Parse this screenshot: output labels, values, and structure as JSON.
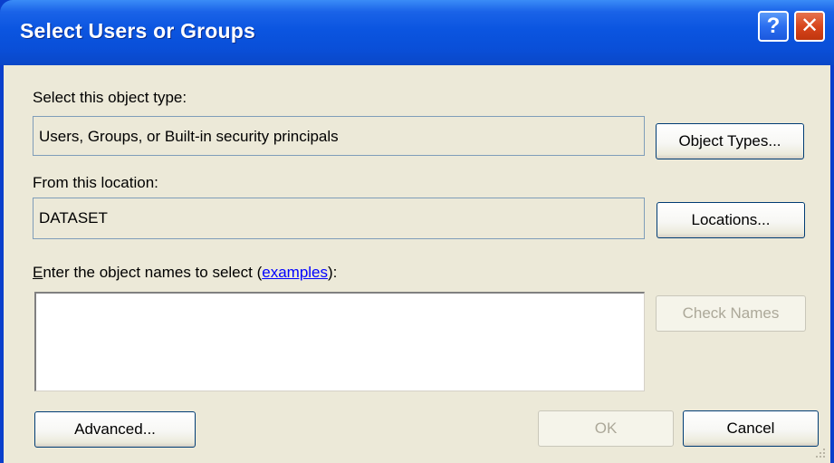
{
  "window": {
    "title": "Select Users or Groups",
    "help_glyph": "?",
    "close_glyph": "✕"
  },
  "object_type": {
    "label": "Select this object type:",
    "value": "Users, Groups, or Built-in security principals",
    "button_label": "Object Types..."
  },
  "location": {
    "label": "From this location:",
    "value": "DATASET",
    "button_label": "Locations..."
  },
  "names": {
    "label_prefix": "nter the object names to select (",
    "label_mnemonic": "E",
    "link_text": "examples",
    "label_suffix": "):",
    "value": "",
    "check_names_label": "Check Names"
  },
  "footer": {
    "advanced_label": "Advanced...",
    "ok_label": "OK",
    "cancel_label": "Cancel"
  }
}
